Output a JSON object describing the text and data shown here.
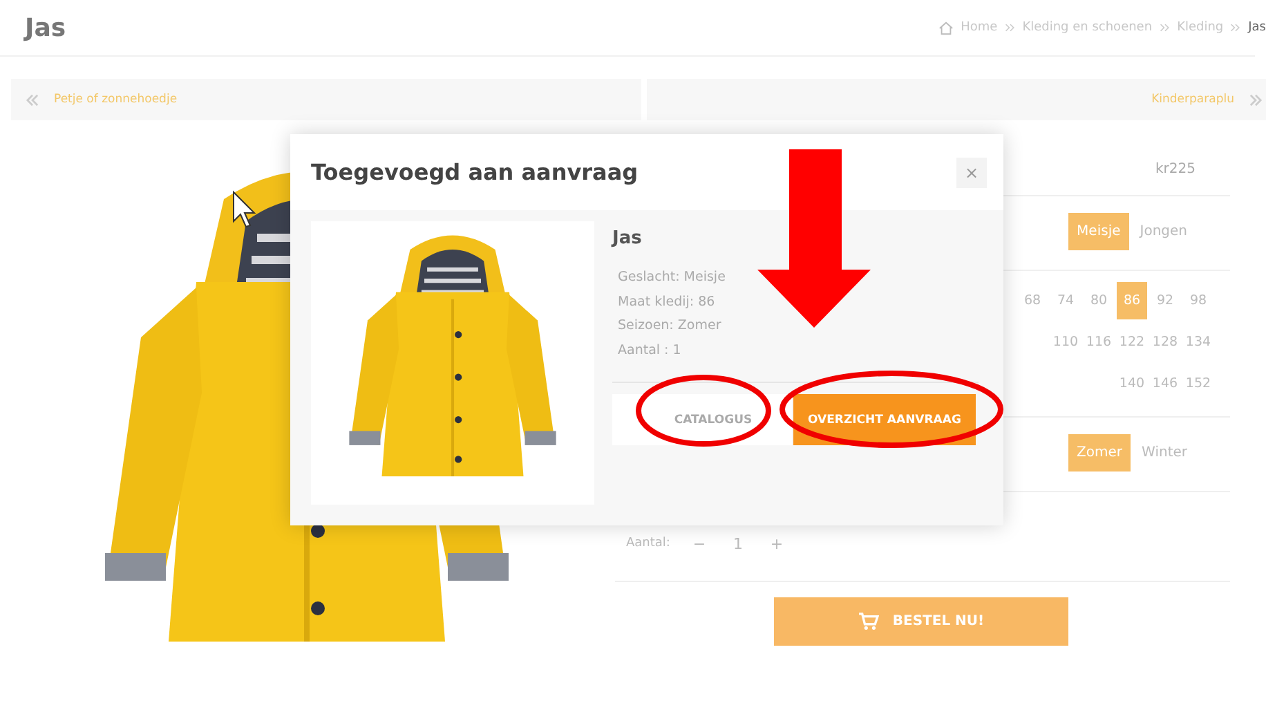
{
  "page_title": "Jas",
  "breadcrumbs": [
    "Home",
    "Kleding en schoenen",
    "Kleding",
    "Jas"
  ],
  "pager": {
    "previous": "Petje of zonnehoedje",
    "next": "Kinderparaplu"
  },
  "product": {
    "price": "kr225",
    "gender": [
      {
        "label": "Meisje",
        "selected": true
      },
      {
        "label": "Jongen",
        "selected": false
      }
    ],
    "sizes": [
      {
        "label": "68",
        "selected": false
      },
      {
        "label": "74",
        "selected": false
      },
      {
        "label": "80",
        "selected": false
      },
      {
        "label": "86",
        "selected": true
      },
      {
        "label": "92",
        "selected": false
      },
      {
        "label": "98",
        "selected": false
      },
      {
        "label": "110",
        "selected": false
      },
      {
        "label": "116",
        "selected": false
      },
      {
        "label": "122",
        "selected": false
      },
      {
        "label": "128",
        "selected": false
      },
      {
        "label": "134",
        "selected": false
      },
      {
        "label": "140",
        "selected": false
      },
      {
        "label": "146",
        "selected": false
      },
      {
        "label": "152",
        "selected": false
      }
    ],
    "season": [
      {
        "label": "Zomer",
        "selected": true
      },
      {
        "label": "Winter",
        "selected": false
      }
    ],
    "quantity": {
      "label": "Aantal:",
      "minus": "−",
      "value": "1",
      "plus": "+"
    },
    "order_button": "BESTEL NU!"
  },
  "modal": {
    "title": "Toegevoegd aan aanvraag",
    "close": "×",
    "item_name": "Jas",
    "details": [
      "Geslacht: Meisje",
      "Maat kledij: 86",
      "Seizoen: Zomer",
      "Aantal : 1"
    ],
    "buttons": [
      {
        "label": "CATALOGUS",
        "kind": "secondary"
      },
      {
        "label": "OVERZICHT AANVRAAG",
        "kind": "primary"
      }
    ]
  }
}
